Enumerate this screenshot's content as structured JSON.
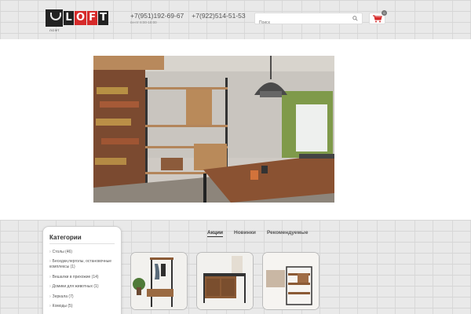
{
  "header": {
    "logo_letters": [
      "L",
      "O",
      "F",
      "T"
    ],
    "logo_subtitle": "ЛОФТ",
    "phones": [
      "+7(951)192-69-67",
      "+7(922)514-51-53"
    ],
    "hours": "пн-пт 8:00-18:00",
    "search_placeholder": "Поиск",
    "cart_count": "0"
  },
  "sidebar": {
    "title": "Категории",
    "items": [
      "Столы (46)",
      "Беседки,перголы, остановочные комплексы (1)",
      "Вешалки в прихожие (14)",
      "Домики для животных (1)",
      "Зеркала (7)",
      "Комоды (5)"
    ]
  },
  "tabs": [
    "Акции",
    "Новинки",
    "Рекомендуемые"
  ],
  "colors": {
    "accent_red": "#d62a2a",
    "logo_dark": "#222222"
  }
}
